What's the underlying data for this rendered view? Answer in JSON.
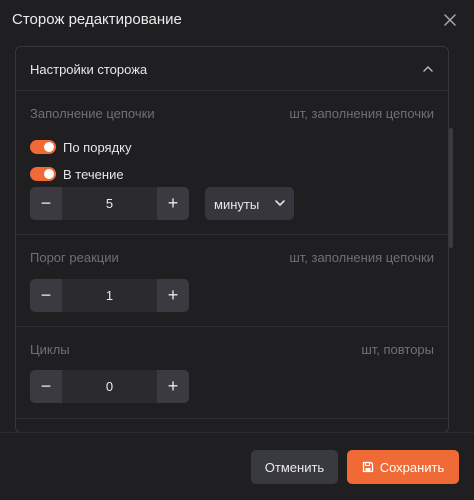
{
  "dialog": {
    "title": "Сторож редактирование",
    "close_icon": "close-icon"
  },
  "panel": {
    "title": "Настройки сторожа",
    "collapse_icon": "chevron-up-icon",
    "sections": {
      "fill": {
        "label": "Заполнение цепочки",
        "unit": "шт, заполнения цепочки",
        "toggles": [
          {
            "label": "По порядку",
            "on": true
          },
          {
            "label": "В течение",
            "on": true
          }
        ],
        "value": "5",
        "unit_select": "минуты"
      },
      "threshold": {
        "label": "Порог реакции",
        "unit": "шт, заполнения цепочки",
        "value": "1"
      },
      "cycles": {
        "label": "Циклы",
        "unit": "шт, повторы",
        "value": "0"
      }
    }
  },
  "stepper": {
    "minus": "−",
    "plus": "+"
  },
  "footer": {
    "cancel_label": "Отменить",
    "save_label": "Сохранить"
  },
  "colors": {
    "accent": "#ef6a35",
    "background": "#1f1f22",
    "control_bg": "#2a2a2f",
    "muted_text": "#6f6f76"
  }
}
